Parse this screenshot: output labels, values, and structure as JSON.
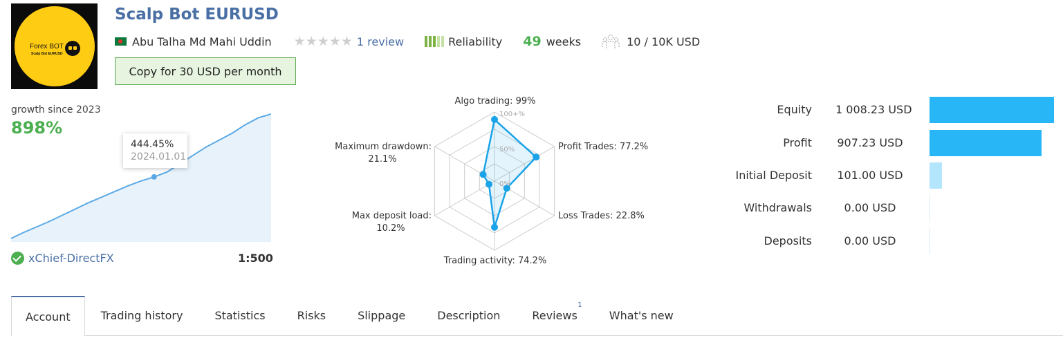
{
  "header": {
    "logo": {
      "text_line1": "Forex BOT",
      "text_line2": "Scalp Bot EURUSD"
    },
    "title": "Scalp Bot EURUSD",
    "author": "Abu Talha Md Mahi Uddin",
    "review_link": "1 review",
    "rating_stars_filled": 0,
    "reliability_label": "Reliability",
    "weeks_value": "49",
    "weeks_label": "weeks",
    "subscribers": "10 / 10K USD",
    "copy_button": "Copy for 30 USD per month"
  },
  "growth": {
    "label": "growth since 2023",
    "value": "898%",
    "tooltip_value": "444.45%",
    "tooltip_date": "2024.01.01",
    "broker": "xChief-DirectFX",
    "leverage": "1:500"
  },
  "chart_data": [
    {
      "type": "area",
      "title": "growth since 2023",
      "y_unit": "%",
      "series": [
        {
          "values": [
            0,
            45,
            85,
            125,
            170,
            215,
            260,
            300,
            340,
            380,
            415,
            444.45,
            480,
            540,
            600,
            660,
            710,
            760,
            820,
            870,
            898
          ]
        }
      ],
      "highlight": {
        "label": "2024.01.01",
        "value": 444.45
      },
      "grid": false
    },
    {
      "type": "radar",
      "ring_labels": [
        "100+%",
        "50%",
        "0%"
      ],
      "axes": [
        "Algo trading",
        "Profit Trades",
        "Loss Trades",
        "Trading activity",
        "Max deposit load",
        "Maximum drawdown"
      ],
      "values": [
        99,
        77.2,
        22.8,
        74.2,
        10.2,
        21.1
      ],
      "labels": {
        "algo": "Algo trading: 99%",
        "profit": "Profit Trades: 77.2%",
        "loss": "Loss Trades: 22.8%",
        "activity": "Trading activity: 74.2%",
        "deposit_load_1": "Max deposit load:",
        "deposit_load_2": "10.2%",
        "drawdown_1": "Maximum drawdown:",
        "drawdown_2": "21.1%"
      }
    },
    {
      "type": "bar",
      "orientation": "horizontal",
      "categories": [
        "Equity",
        "Profit",
        "Initial Deposit",
        "Withdrawals",
        "Deposits"
      ],
      "values": [
        1008.23,
        907.23,
        101.0,
        0.0,
        0.0
      ],
      "unit": "USD"
    }
  ],
  "balance": {
    "rows": [
      {
        "label": "Equity",
        "value": "1 008.23 USD"
      },
      {
        "label": "Profit",
        "value": "907.23 USD"
      },
      {
        "label": "Initial Deposit",
        "value": "101.00 USD"
      },
      {
        "label": "Withdrawals",
        "value": "0.00 USD"
      },
      {
        "label": "Deposits",
        "value": "0.00 USD"
      }
    ]
  },
  "tabs": [
    {
      "label": "Account",
      "active": true
    },
    {
      "label": "Trading history"
    },
    {
      "label": "Statistics"
    },
    {
      "label": "Risks"
    },
    {
      "label": "Slippage"
    },
    {
      "label": "Description"
    },
    {
      "label": "Reviews",
      "badge": "1"
    },
    {
      "label": "What's new"
    }
  ],
  "colors": {
    "accent_blue": "#4a6fa5",
    "green": "#4caf50",
    "chart_line": "#5aa9e6",
    "radar_line": "#1aa3e8",
    "bar_blue": "#29b6f6"
  }
}
